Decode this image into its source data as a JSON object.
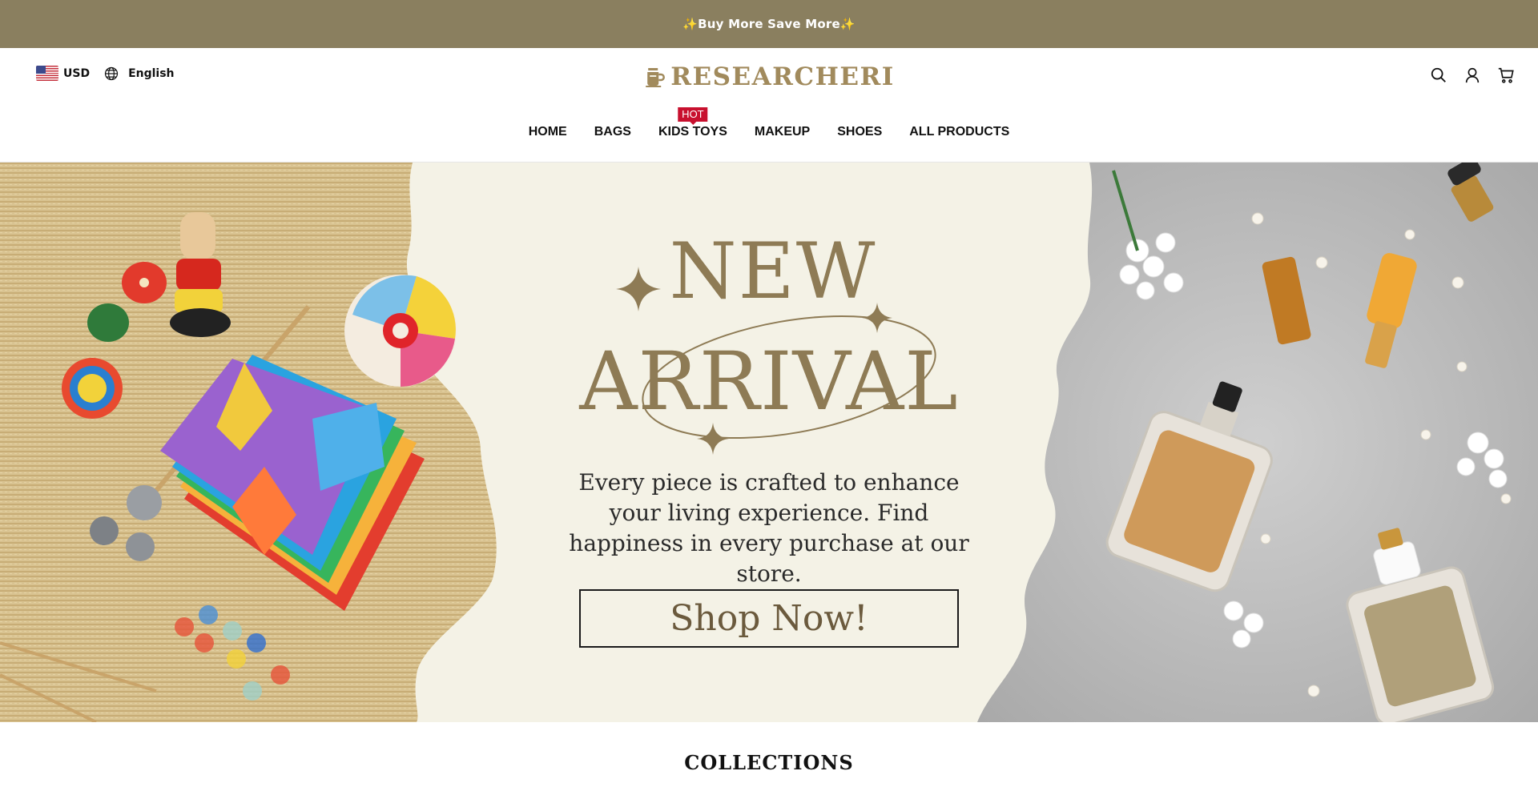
{
  "announcement": {
    "text": "✨Buy More Save More✨"
  },
  "header": {
    "currency": {
      "code": "USD",
      "flag_icon": "us-flag-icon"
    },
    "language": {
      "label": "English",
      "icon": "globe-icon"
    },
    "logo": {
      "text": "RESEARCHERI",
      "icon": "cup-icon"
    },
    "actions": [
      {
        "name": "search-icon"
      },
      {
        "name": "account-icon"
      },
      {
        "name": "cart-icon"
      }
    ]
  },
  "nav": {
    "items": [
      {
        "label": "HOME"
      },
      {
        "label": "BAGS"
      },
      {
        "label": "KIDS TOYS",
        "badge": "HOT"
      },
      {
        "label": "MAKEUP"
      },
      {
        "label": "SHOES"
      },
      {
        "label": "ALL PRODUCTS"
      }
    ]
  },
  "hero": {
    "title_line1": "NEW",
    "title_line2": "ARRIVAL",
    "tagline": "Every piece is crafted to enhance your living experience. Find happiness in every purchase at our store.",
    "cta": "Shop Now!"
  },
  "collections": {
    "title": "COLLECTIONS"
  },
  "colors": {
    "accent": "#8a7f5f",
    "brand": "#a18a5c",
    "hot_badge": "#c8102e",
    "hero_bg": "#f4f2e6"
  }
}
